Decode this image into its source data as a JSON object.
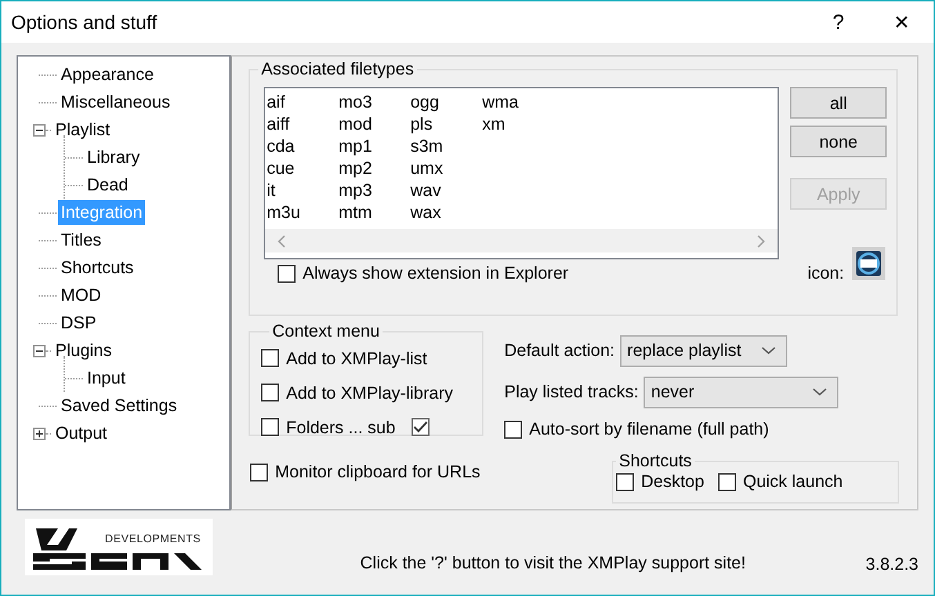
{
  "window": {
    "title": "Options and stuff",
    "help": "?",
    "close": "✕"
  },
  "tree": [
    {
      "label": "Appearance",
      "selected": false
    },
    {
      "label": "Miscellaneous",
      "selected": false
    },
    {
      "label": "Playlist",
      "selected": false,
      "expanded": true,
      "children": [
        {
          "label": "Library",
          "selected": false
        },
        {
          "label": "Dead",
          "selected": false
        }
      ]
    },
    {
      "label": "Integration",
      "selected": true
    },
    {
      "label": "Titles",
      "selected": false
    },
    {
      "label": "Shortcuts",
      "selected": false
    },
    {
      "label": "MOD",
      "selected": false
    },
    {
      "label": "DSP",
      "selected": false
    },
    {
      "label": "Plugins",
      "selected": false,
      "expanded": true,
      "children": [
        {
          "label": "Input",
          "selected": false
        }
      ]
    },
    {
      "label": "Saved Settings",
      "selected": false
    },
    {
      "label": "Output",
      "selected": false,
      "expanded": false
    }
  ],
  "filetypes": {
    "title": "Associated filetypes",
    "items": [
      "aif",
      "aiff",
      "cda",
      "cue",
      "it",
      "m3u",
      "mo3",
      "mod",
      "mp1",
      "mp2",
      "mp3",
      "mtm",
      "ogg",
      "pls",
      "s3m",
      "umx",
      "wav",
      "wax",
      "wma",
      "xm"
    ],
    "buttons": [
      {
        "label": "all",
        "disabled": false
      },
      {
        "label": "none",
        "disabled": false
      },
      {
        "label": "Apply",
        "disabled": true
      }
    ],
    "show_extension": {
      "label": "Always show extension in Explorer",
      "checked": false
    },
    "icon_label": "icon:"
  },
  "context_menu": {
    "title": "Context menu",
    "options": [
      {
        "label": "Add to XMPlay-list",
        "checked": false
      },
      {
        "label": "Add to XMPlay-library",
        "checked": false
      },
      {
        "label": "Folders ... sub",
        "checked": false,
        "sub_checked": true
      }
    ]
  },
  "default_action": {
    "label": "Default action:",
    "value": "replace playlist"
  },
  "play_listed": {
    "label": "Play listed tracks:",
    "value": "never"
  },
  "auto_sort": {
    "label": "Auto-sort by filename (full path)",
    "checked": false
  },
  "monitor_clipboard": {
    "label": "Monitor clipboard for URLs",
    "checked": false
  },
  "shortcuts": {
    "title": "Shortcuts",
    "options": [
      {
        "label": "Desktop",
        "checked": false
      },
      {
        "label": "Quick launch",
        "checked": false
      }
    ]
  },
  "logo_text": "DEVELOPMENTS",
  "footer": "Click the '?' button to visit the XMPlay support site!",
  "version": "3.8.2.3"
}
